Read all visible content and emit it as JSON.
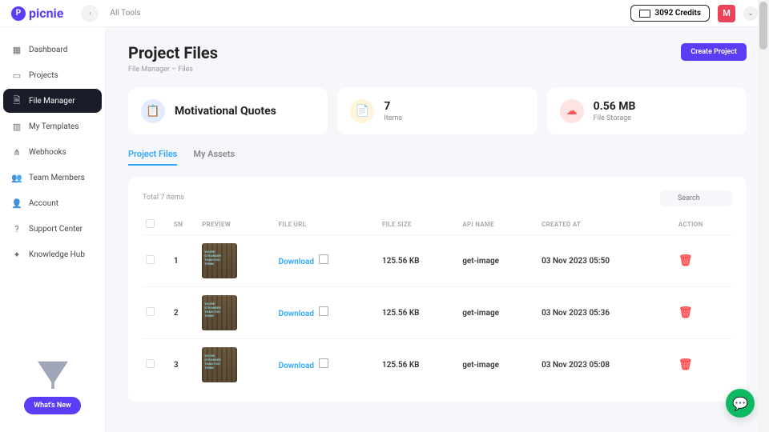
{
  "header": {
    "brand": "picnie",
    "all_tools": "All Tools",
    "credits": "3092 Credits",
    "avatar_letter": "M"
  },
  "sidebar": {
    "items": [
      {
        "label": "Dashboard",
        "icon": "dashboard-icon"
      },
      {
        "label": "Projects",
        "icon": "projects-icon"
      },
      {
        "label": "File Manager",
        "icon": "file-manager-icon"
      },
      {
        "label": "My Templates",
        "icon": "templates-icon"
      },
      {
        "label": "Webhooks",
        "icon": "webhooks-icon"
      },
      {
        "label": "Team Members",
        "icon": "team-icon"
      },
      {
        "label": "Account",
        "icon": "account-icon"
      },
      {
        "label": "Support Center",
        "icon": "support-icon"
      },
      {
        "label": "Knowledge Hub",
        "icon": "knowledge-icon"
      }
    ],
    "whats_new": "What's New"
  },
  "page": {
    "title": "Project Files",
    "breadcrumb_a": "File Manager",
    "breadcrumb_sep": "–",
    "breadcrumb_b": "Files",
    "create_btn": "Create Project"
  },
  "stats": {
    "project_name": "Motivational Quotes",
    "items_value": "7",
    "items_label": "Items",
    "storage_value": "0.56 MB",
    "storage_label": "File Storage"
  },
  "tabs": {
    "project_files": "Project Files",
    "my_assets": "My Assets"
  },
  "table": {
    "total": "Total 7 items",
    "search_placeholder": "Search",
    "headers": {
      "sn": "SN",
      "preview": "PREVIEW",
      "file_url": "FILE URL",
      "file_size": "FILE SIZE",
      "api_name": "API NAME",
      "created_at": "CREATED AT",
      "action": "ACTION"
    },
    "download_label": "Download",
    "rows": [
      {
        "sn": "1",
        "size": "125.56 KB",
        "api": "get-image",
        "created": "03 Nov 2023 05:50"
      },
      {
        "sn": "2",
        "size": "125.56 KB",
        "api": "get-image",
        "created": "03 Nov 2023 05:36"
      },
      {
        "sn": "3",
        "size": "125.56 KB",
        "api": "get-image",
        "created": "03 Nov 2023 05:08"
      }
    ]
  }
}
